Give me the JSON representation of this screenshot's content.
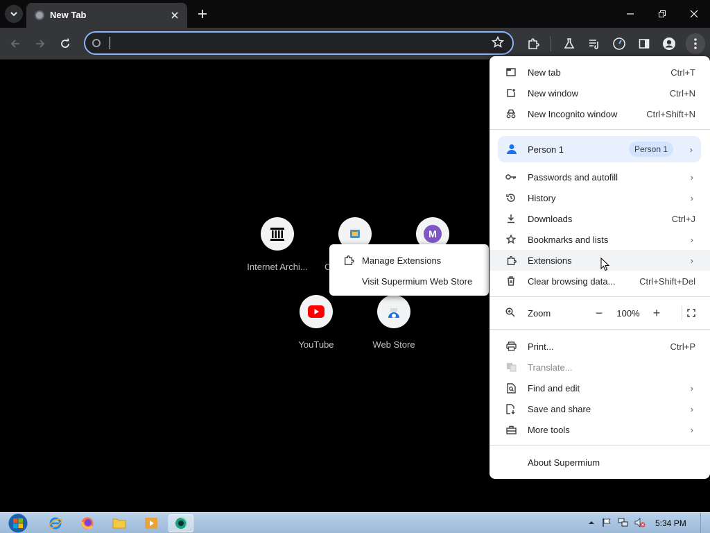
{
  "window": {
    "tab_title": "New Tab"
  },
  "toolbar": {
    "address_value": ""
  },
  "shortcuts": [
    {
      "label": "Internet Archi...",
      "icon": "archive-icon"
    },
    {
      "label": "C",
      "icon": "extension-store-icon"
    },
    {
      "label": "",
      "icon": "m-avatar-icon",
      "letter": "M"
    },
    {
      "label": "YouTube",
      "icon": "youtube-icon"
    },
    {
      "label": "Web Store",
      "icon": "web-store-icon"
    }
  ],
  "extensions_submenu": {
    "manage": "Manage Extensions",
    "visit_store": "Visit Supermium Web Store"
  },
  "menu": {
    "new_tab": {
      "label": "New tab",
      "shortcut": "Ctrl+T"
    },
    "new_window": {
      "label": "New window",
      "shortcut": "Ctrl+N"
    },
    "new_incognito": {
      "label": "New Incognito window",
      "shortcut": "Ctrl+Shift+N"
    },
    "profile": {
      "label": "Person 1",
      "badge": "Person 1"
    },
    "passwords": {
      "label": "Passwords and autofill"
    },
    "history": {
      "label": "History"
    },
    "downloads": {
      "label": "Downloads",
      "shortcut": "Ctrl+J"
    },
    "bookmarks": {
      "label": "Bookmarks and lists"
    },
    "extensions": {
      "label": "Extensions"
    },
    "clear_data": {
      "label": "Clear browsing data...",
      "shortcut": "Ctrl+Shift+Del"
    },
    "zoom": {
      "label": "Zoom",
      "value": "100%",
      "minus": "−",
      "plus": "+"
    },
    "print": {
      "label": "Print...",
      "shortcut": "Ctrl+P"
    },
    "translate": {
      "label": "Translate..."
    },
    "find_edit": {
      "label": "Find and edit"
    },
    "save_share": {
      "label": "Save and share"
    },
    "more_tools": {
      "label": "More tools"
    },
    "about": {
      "label": "About Supermium"
    }
  },
  "taskbar": {
    "clock": "5:34 PM"
  },
  "colors": {
    "accent": "#8ab4f8",
    "menu_bg": "#ffffff",
    "profile_bg": "#e8f0fe",
    "youtube_red": "#ff0000"
  }
}
